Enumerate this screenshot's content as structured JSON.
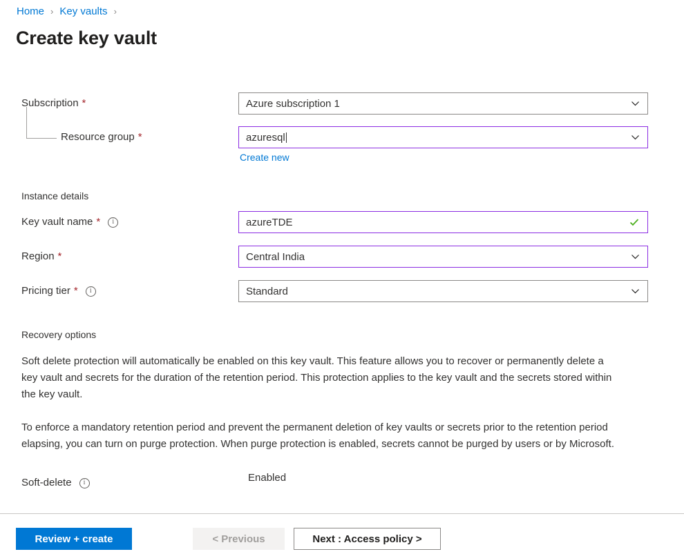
{
  "breadcrumb": {
    "items": [
      {
        "label": "Home"
      },
      {
        "label": "Key vaults"
      }
    ],
    "separator": "›"
  },
  "page": {
    "title": "Create key vault"
  },
  "form": {
    "project_details": {
      "subscription": {
        "label": "Subscription",
        "required_marker": "*",
        "value": "Azure subscription 1",
        "control": "dropdown",
        "focused": false
      },
      "resource_group": {
        "label": "Resource group",
        "required_marker": "*",
        "value": "azuresql",
        "control": "dropdown",
        "focused": true,
        "create_new_link": "Create new"
      }
    },
    "instance_details": {
      "heading": "Instance details",
      "key_vault_name": {
        "label": "Key vault name",
        "required_marker": "*",
        "value": "azureTDE",
        "control": "textbox",
        "focused": true,
        "validated": true
      },
      "region": {
        "label": "Region",
        "required_marker": "*",
        "value": "Central India",
        "control": "dropdown",
        "focused": true
      },
      "pricing_tier": {
        "label": "Pricing tier",
        "required_marker": "*",
        "value": "Standard",
        "control": "dropdown",
        "focused": false
      }
    },
    "recovery_options": {
      "heading": "Recovery options",
      "paragraph_1": "Soft delete protection will automatically be enabled on this key vault. This feature allows you to recover or permanently delete a key vault and secrets for the duration of the retention period. This protection applies to the key vault and the secrets stored within the key vault.",
      "paragraph_2": "To enforce a mandatory retention period and prevent the permanent deletion of key vaults or secrets prior to the retention period elapsing, you can turn on purge protection. When purge protection is enabled, secrets cannot be purged by users or by Microsoft.",
      "soft_delete": {
        "label": "Soft-delete",
        "value": "Enabled"
      }
    }
  },
  "footer": {
    "review_create": "Review + create",
    "previous": "< Previous",
    "next": "Next : Access policy >"
  },
  "icons": {
    "info": "ℹ",
    "info_glyph": "i"
  },
  "colors": {
    "accent_blue": "#0078d4",
    "link_blue": "#0078d4",
    "required_red": "#a4262c",
    "focus_purple": "#8a2be2",
    "valid_green": "#498205",
    "border_gray": "#8a8886",
    "divider_gray": "#c8c6c4",
    "disabled_bg": "#f3f2f1",
    "disabled_text": "#a19f9d"
  }
}
